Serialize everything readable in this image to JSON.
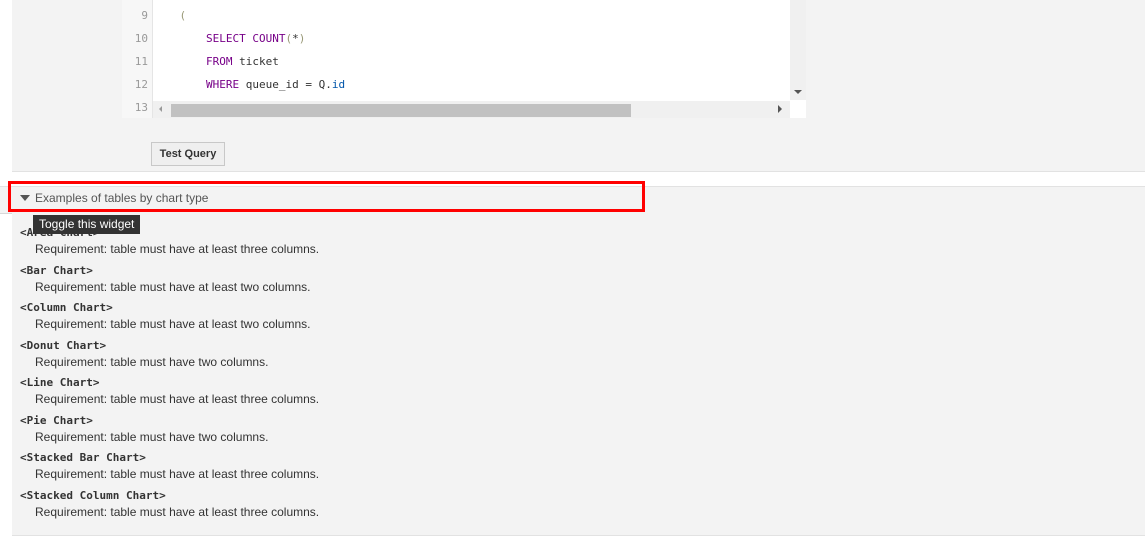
{
  "editor": {
    "lines": [
      {
        "num": "9",
        "tokens": [
          {
            "t": "    ",
            "c": ""
          },
          {
            "t": "(",
            "c": "paren"
          }
        ]
      },
      {
        "num": "10",
        "tokens": [
          {
            "t": "        ",
            "c": ""
          },
          {
            "t": "SELECT COUNT",
            "c": "kw"
          },
          {
            "t": "(",
            "c": "paren"
          },
          {
            "t": "*",
            "c": ""
          },
          {
            "t": ")",
            "c": "paren"
          }
        ]
      },
      {
        "num": "11",
        "tokens": [
          {
            "t": "        ",
            "c": ""
          },
          {
            "t": "FROM",
            "c": "kw"
          },
          {
            "t": " ticket",
            "c": ""
          }
        ]
      },
      {
        "num": "12",
        "tokens": [
          {
            "t": "        ",
            "c": ""
          },
          {
            "t": "WHERE",
            "c": "kw"
          },
          {
            "t": " queue_id = Q.",
            "c": ""
          },
          {
            "t": "id",
            "c": "prop"
          }
        ]
      },
      {
        "num": "13",
        "tokens": []
      }
    ]
  },
  "test_query_button": "Test Query",
  "widget": {
    "title": "Examples of tables by chart type",
    "tooltip": "Toggle this widget",
    "entries": [
      {
        "name": "<Area Chart>",
        "requirement": "Requirement: table must have at least three columns."
      },
      {
        "name": "<Bar Chart>",
        "requirement": "Requirement: table must have at least two columns."
      },
      {
        "name": "<Column Chart>",
        "requirement": "Requirement: table must have at least two columns."
      },
      {
        "name": "<Donut Chart>",
        "requirement": "Requirement: table must have two columns."
      },
      {
        "name": "<Line Chart>",
        "requirement": "Requirement: table must have at least three columns."
      },
      {
        "name": "<Pie Chart>",
        "requirement": "Requirement: table must have two columns."
      },
      {
        "name": "<Stacked Bar Chart>",
        "requirement": "Requirement: table must have at least three columns."
      },
      {
        "name": "<Stacked Column Chart>",
        "requirement": "Requirement: table must have at least three columns."
      }
    ]
  }
}
